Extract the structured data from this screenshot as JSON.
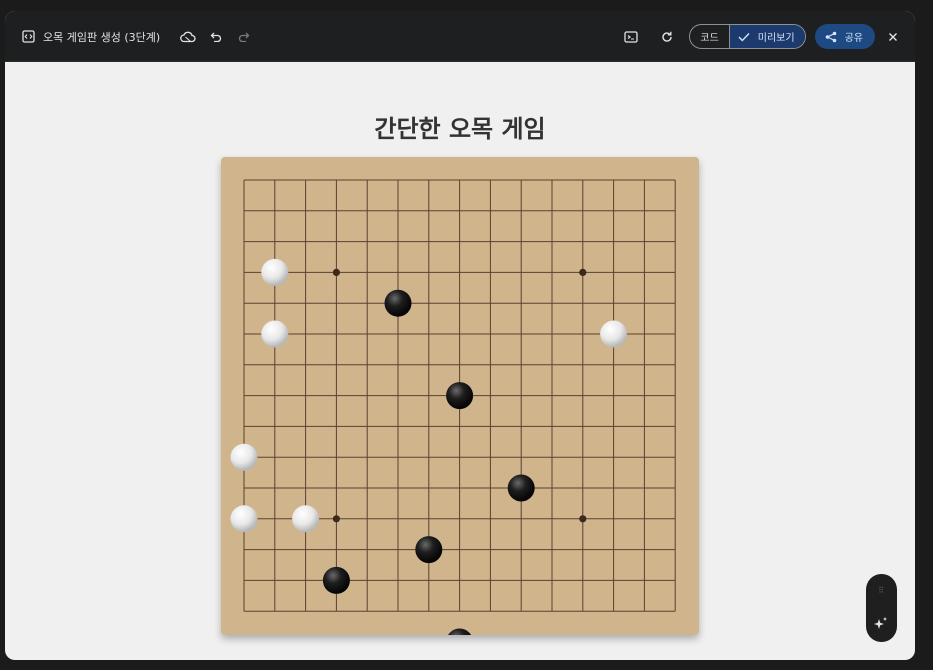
{
  "toolbar": {
    "title": "오목 게임판 생성 (3단계)",
    "code_label": "코드",
    "preview_label": "미리보기",
    "share_label": "공유"
  },
  "icons": {
    "code": "code-file-icon",
    "cloud": "cloud-icon",
    "undo": "undo-icon",
    "redo": "redo-icon",
    "terminal": "terminal-icon",
    "refresh": "refresh-icon",
    "check": "check-icon",
    "share": "share-icon",
    "close": "close-icon",
    "drag": "drag-handle-icon",
    "sparkle": "sparkle-icon"
  },
  "colors": {
    "board": "#d0b48c",
    "grid_line": "#5a4030",
    "share_button": "#1d4a82",
    "preview_active": "#1d3a6e"
  },
  "game": {
    "title": "간단한 오목 게임",
    "board_size": 15,
    "star_points": [
      [
        3,
        3
      ],
      [
        3,
        11
      ],
      [
        11,
        3
      ],
      [
        11,
        11
      ]
    ],
    "black_stones": [
      [
        5,
        4
      ],
      [
        7,
        7
      ],
      [
        6,
        12
      ],
      [
        9,
        10
      ],
      [
        3,
        13
      ],
      [
        7,
        15
      ]
    ],
    "white_stones": [
      [
        0,
        9
      ],
      [
        0,
        11
      ],
      [
        1,
        3
      ],
      [
        2,
        11
      ],
      [
        1,
        5
      ],
      [
        12,
        5
      ]
    ]
  }
}
